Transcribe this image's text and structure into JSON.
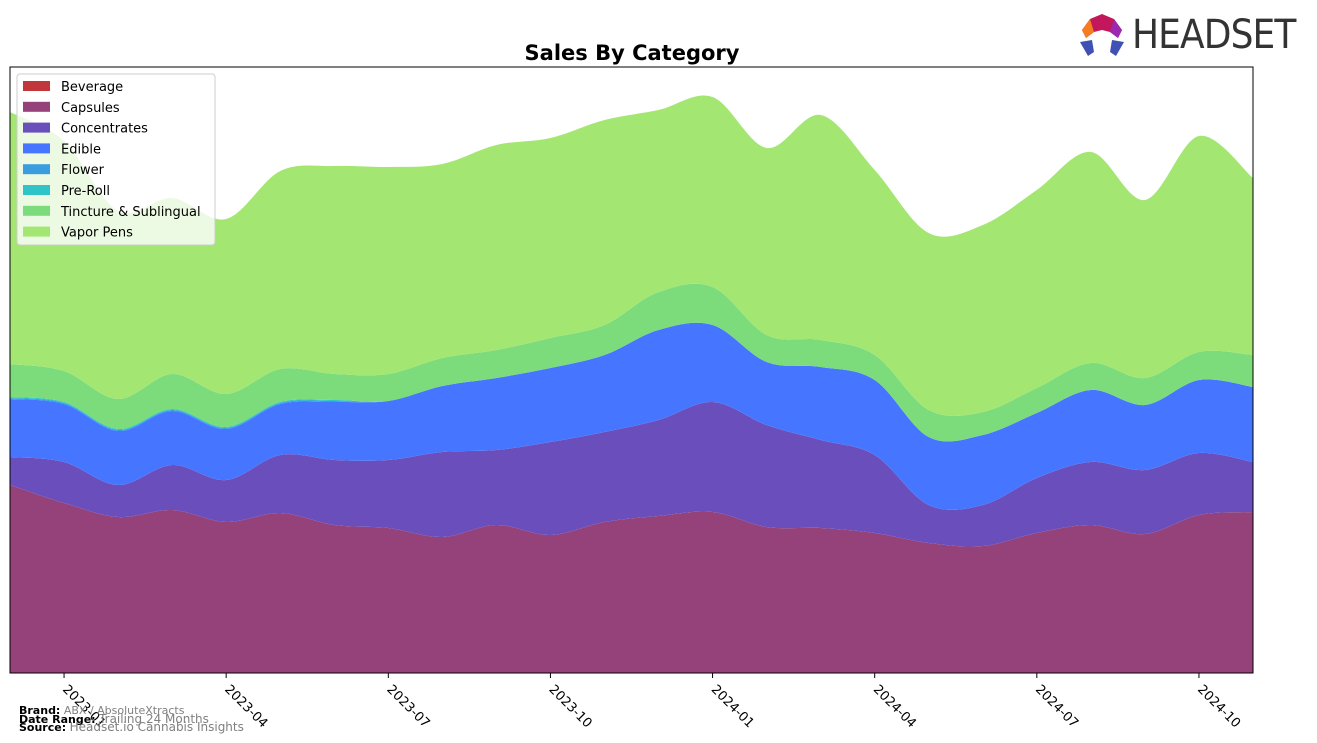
{
  "brand_logo": {
    "text": "HEADSET"
  },
  "footer": {
    "brand_label": "Brand:",
    "brand_value": "ABX / AbsoluteXtracts",
    "date_label": "Date Range:",
    "date_value": "Trailing 24 Months",
    "source_label": "Source:",
    "source_value": "Headset.io Cannabis Insights"
  },
  "chart_data": {
    "type": "area",
    "stacked": true,
    "title": "Sales By Category",
    "xlabel": "",
    "ylabel": "",
    "x": [
      "2022-12",
      "2023-01",
      "2023-02",
      "2023-03",
      "2023-04",
      "2023-05",
      "2023-06",
      "2023-07",
      "2023-08",
      "2023-09",
      "2023-10",
      "2023-11",
      "2023-12",
      "2024-01",
      "2024-02",
      "2024-03",
      "2024-04",
      "2024-05",
      "2024-06",
      "2024-07",
      "2024-08",
      "2024-09",
      "2024-10",
      "2024-11"
    ],
    "xticks": [
      "2023-01",
      "2023-04",
      "2023-07",
      "2023-10",
      "2024-01",
      "2024-04",
      "2024-07",
      "2024-10"
    ],
    "ylim": [
      0,
      606
    ],
    "yticks_visible": false,
    "grid": false,
    "legend_position": "top-left",
    "series": [
      {
        "name": "Beverage",
        "color": "#c1363a",
        "values": [
          0,
          0,
          0,
          0,
          0,
          0,
          0,
          0,
          0,
          0,
          0,
          0,
          0,
          0,
          0,
          0,
          0,
          0,
          0,
          0,
          0,
          0,
          0,
          0
        ]
      },
      {
        "name": "Capsules",
        "color": "#96427a",
        "values": [
          188,
          170,
          156,
          163,
          151,
          160,
          148,
          145,
          136,
          148,
          138,
          151,
          157,
          161,
          146,
          145,
          140,
          130,
          127,
          140,
          148,
          139,
          158,
          161
        ]
      },
      {
        "name": "Concentrates",
        "color": "#6a4fbc",
        "values": [
          28,
          41,
          32,
          45,
          42,
          58,
          65,
          68,
          85,
          75,
          93,
          90,
          96,
          110,
          102,
          88,
          78,
          38,
          41,
          55,
          63,
          64,
          62,
          50
        ]
      },
      {
        "name": "Edible",
        "color": "#4676ff",
        "values": [
          58,
          58,
          54,
          54,
          51,
          51,
          58,
          59,
          66,
          72,
          74,
          77,
          90,
          77,
          63,
          73,
          75,
          68,
          70,
          65,
          72,
          65,
          73,
          75
        ]
      },
      {
        "name": "Flower",
        "color": "#3a9de0",
        "values": [
          1,
          1,
          1,
          1,
          1,
          1,
          1,
          0,
          0,
          0,
          0,
          0,
          0,
          0,
          0,
          0,
          0,
          0,
          0,
          0,
          0,
          0,
          0,
          0
        ]
      },
      {
        "name": "Pre-Roll",
        "color": "#2ec4c8",
        "values": [
          1,
          1,
          1,
          1,
          1,
          1,
          1,
          0,
          0,
          0,
          0,
          0,
          0,
          0,
          0,
          0,
          0,
          0,
          0,
          0,
          0,
          0,
          0,
          0
        ]
      },
      {
        "name": "Tincture & Sublingual",
        "color": "#7cdc7c",
        "values": [
          33,
          31,
          30,
          35,
          33,
          33,
          26,
          27,
          28,
          28,
          30,
          30,
          38,
          38,
          27,
          27,
          25,
          27,
          23,
          25,
          27,
          27,
          28,
          32
        ]
      },
      {
        "name": "Vapor Pens",
        "color": "#a4e672",
        "values": [
          252,
          230,
          188,
          176,
          175,
          198,
          208,
          207,
          194,
          205,
          200,
          205,
          182,
          190,
          187,
          225,
          185,
          177,
          187,
          198,
          211,
          178,
          216,
          177
        ]
      }
    ]
  }
}
